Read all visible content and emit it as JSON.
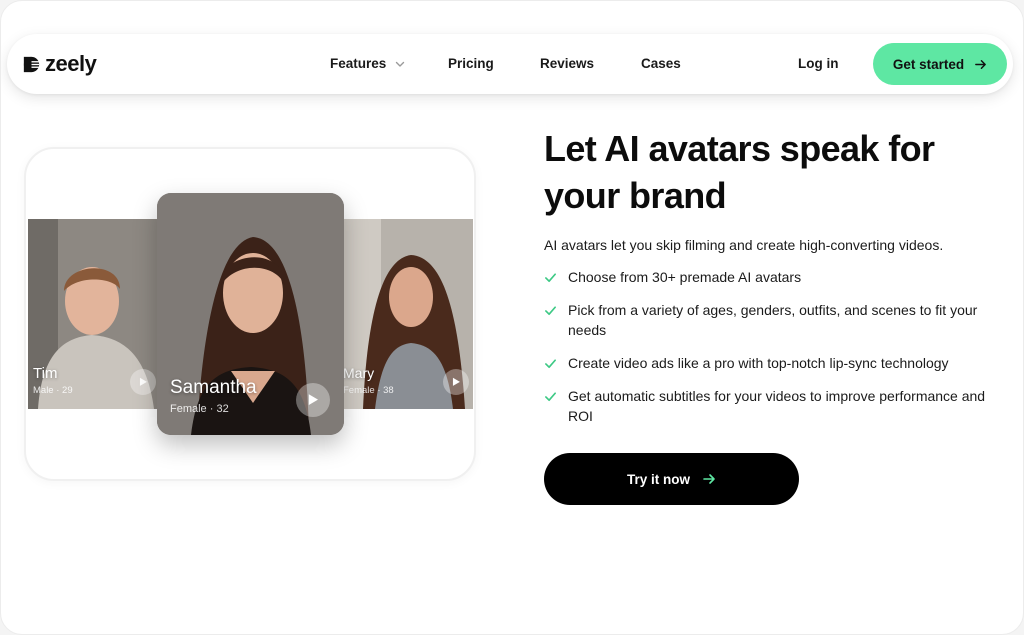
{
  "nav": {
    "logo_text": "zeely",
    "links": [
      {
        "label": "Features",
        "has_dropdown": true
      },
      {
        "label": "Pricing"
      },
      {
        "label": "Reviews"
      },
      {
        "label": "Cases"
      }
    ],
    "login_label": "Log in",
    "cta_label": "Get started"
  },
  "hero": {
    "title": "Let AI avatars speak for your brand",
    "intro": "AI avatars let you skip filming and create high-converting videos.",
    "features": [
      "Choose from 30+ premade AI avatars",
      "Pick from a variety of ages, genders, outfits, and scenes to fit your needs",
      "Create video ads like a pro with top-notch lip-sync technology",
      "Get automatic subtitles for your videos to improve performance and ROI"
    ],
    "cta_label": "Try it now"
  },
  "avatars": [
    {
      "name": "Tim",
      "meta": "Male · 29"
    },
    {
      "name": "Samantha",
      "meta": "Female · 32"
    },
    {
      "name": "Mary",
      "meta": "Female · 38"
    }
  ],
  "colors": {
    "accent_green": "#5ee7a3",
    "check_green": "#3dc985",
    "cta_dark": "#000000"
  },
  "icons": [
    "logo-mark-icon",
    "chevron-down-icon",
    "arrow-right-icon",
    "check-icon",
    "play-icon"
  ]
}
